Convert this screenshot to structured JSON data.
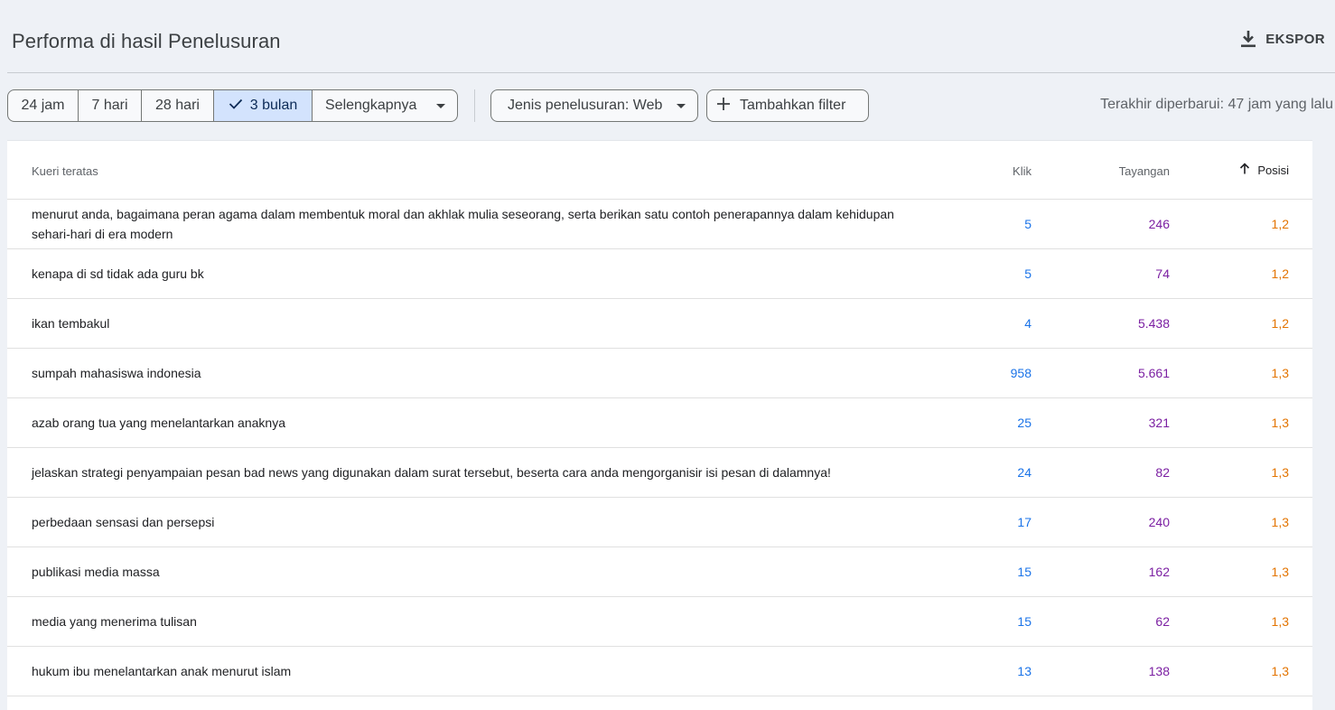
{
  "header": {
    "title": "Performa di hasil Penelusuran",
    "export_label": "EKSPOR",
    "export_icon": "download-icon"
  },
  "filters": {
    "date_ranges": [
      {
        "label": "24 jam",
        "active": false
      },
      {
        "label": "7 hari",
        "active": false
      },
      {
        "label": "28 hari",
        "active": false
      },
      {
        "label": "3 bulan",
        "active": true
      },
      {
        "label": "Selengkapnya",
        "active": false
      }
    ],
    "search_type_label": "Jenis penelusuran: Web",
    "add_filter_label": "Tambahkan filter",
    "last_updated": "Terakhir diperbarui: 47 jam yang lalu"
  },
  "table": {
    "columns": {
      "query": "Kueri teratas",
      "clicks": "Klik",
      "impressions": "Tayangan",
      "position": "Posisi"
    },
    "sort": {
      "column": "position",
      "direction": "ascending"
    },
    "rows": [
      {
        "query": "menurut anda, bagaimana peran agama dalam membentuk moral dan akhlak mulia seseorang, serta berikan satu contoh penerapannya dalam kehidupan sehari-hari di era modern",
        "clicks": "5",
        "impressions": "246",
        "position": "1,2"
      },
      {
        "query": "kenapa di sd tidak ada guru bk",
        "clicks": "5",
        "impressions": "74",
        "position": "1,2"
      },
      {
        "query": "ikan tembakul",
        "clicks": "4",
        "impressions": "5.438",
        "position": "1,2"
      },
      {
        "query": "sumpah mahasiswa indonesia",
        "clicks": "958",
        "impressions": "5.661",
        "position": "1,3"
      },
      {
        "query": "azab orang tua yang menelantarkan anaknya",
        "clicks": "25",
        "impressions": "321",
        "position": "1,3"
      },
      {
        "query": "jelaskan strategi penyampaian pesan bad news yang digunakan dalam surat tersebut, beserta cara anda mengorganisir isi pesan di dalamnya!",
        "clicks": "24",
        "impressions": "82",
        "position": "1,3"
      },
      {
        "query": "perbedaan sensasi dan persepsi",
        "clicks": "17",
        "impressions": "240",
        "position": "1,3"
      },
      {
        "query": "publikasi media massa",
        "clicks": "15",
        "impressions": "162",
        "position": "1,3"
      },
      {
        "query": "media yang menerima tulisan",
        "clicks": "15",
        "impressions": "62",
        "position": "1,3"
      },
      {
        "query": "hukum ibu menelantarkan anak menurut islam",
        "clicks": "13",
        "impressions": "138",
        "position": "1,3"
      }
    ]
  },
  "colors": {
    "clicks": "#1a73e8",
    "impressions": "#7b1fa2",
    "position": "#e37400",
    "active_chip": "#d3e3fd"
  }
}
